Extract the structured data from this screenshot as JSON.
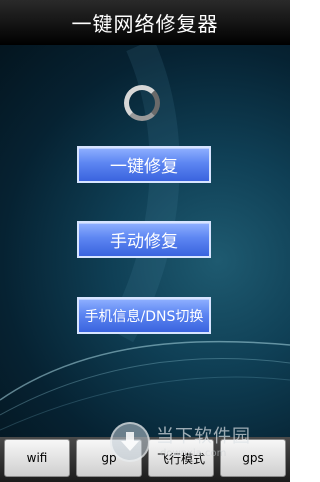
{
  "app": {
    "title": "一键网络修复器"
  },
  "buttons": {
    "one_click_repair": "一键修复",
    "manual_repair": "手动修复",
    "phone_info_dns": "手机信息/DNS切换"
  },
  "tabs": [
    {
      "label": "wifi"
    },
    {
      "label": "gp"
    },
    {
      "label": "飞行模式"
    },
    {
      "label": "gps"
    }
  ],
  "watermark": {
    "text": "当下软件园",
    "url": "downxia.com"
  },
  "colors": {
    "titlebar": "#000000",
    "button_fill": "#4f78e8",
    "button_border": "#d7e4ff",
    "background": "#0f3f55"
  },
  "icons": {
    "loading": "spinner-icon",
    "watermark": "download-logo-icon"
  }
}
